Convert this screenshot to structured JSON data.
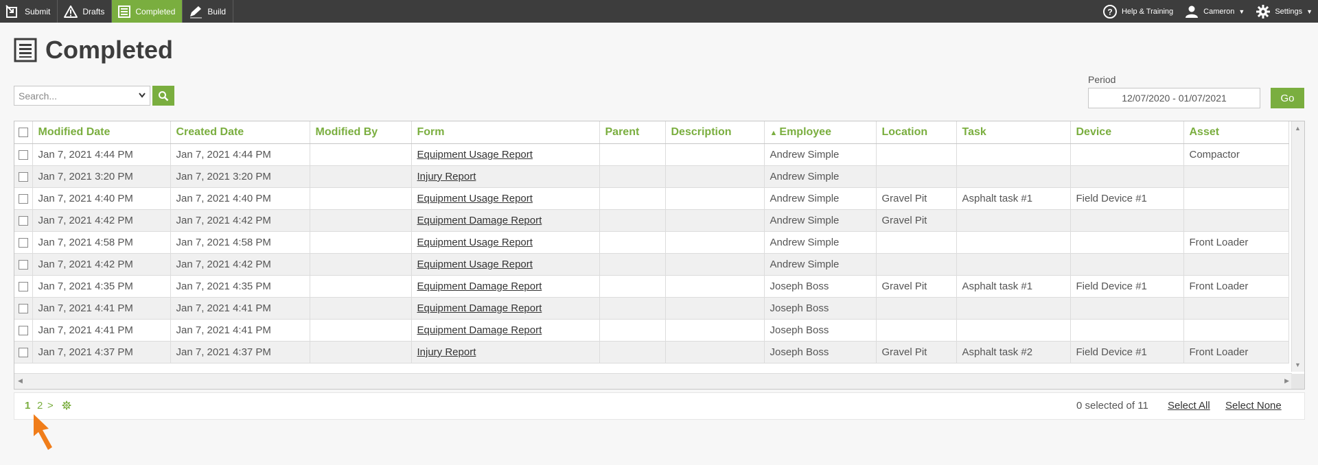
{
  "nav": {
    "items": [
      {
        "label": "Submit",
        "icon": "submit-icon",
        "active": false
      },
      {
        "label": "Drafts",
        "icon": "warning-icon",
        "active": false
      },
      {
        "label": "Completed",
        "icon": "document-icon",
        "active": true
      },
      {
        "label": "Build",
        "icon": "pencil-icon",
        "active": false
      }
    ],
    "help_label": "Help & Training",
    "user_label": "Cameron",
    "settings_label": "Settings"
  },
  "page": {
    "title": "Completed"
  },
  "search": {
    "placeholder": "Search..."
  },
  "period": {
    "label": "Period",
    "value": "12/07/2020 - 01/07/2021",
    "go_label": "Go"
  },
  "table": {
    "columns": [
      "Modified Date",
      "Created Date",
      "Modified By",
      "Form",
      "Parent",
      "Description",
      "Employee",
      "Location",
      "Task",
      "Device",
      "Asset"
    ],
    "sorted_column": "Employee",
    "rows": [
      [
        "Jan 7, 2021 4:44 PM",
        "Jan 7, 2021 4:44 PM",
        "",
        "Equipment Usage Report",
        "",
        "",
        "Andrew Simple",
        "",
        "",
        "",
        "Compactor"
      ],
      [
        "Jan 7, 2021 3:20 PM",
        "Jan 7, 2021 3:20 PM",
        "",
        "Injury Report",
        "",
        "",
        "Andrew Simple",
        "",
        "",
        "",
        ""
      ],
      [
        "Jan 7, 2021 4:40 PM",
        "Jan 7, 2021 4:40 PM",
        "",
        "Equipment Usage Report",
        "",
        "",
        "Andrew Simple",
        "Gravel Pit",
        "Asphalt task #1",
        "Field Device #1",
        ""
      ],
      [
        "Jan 7, 2021 4:42 PM",
        "Jan 7, 2021 4:42 PM",
        "",
        "Equipment Damage Report",
        "",
        "",
        "Andrew Simple",
        "Gravel Pit",
        "",
        "",
        ""
      ],
      [
        "Jan 7, 2021 4:58 PM",
        "Jan 7, 2021 4:58 PM",
        "",
        "Equipment Usage Report",
        "",
        "",
        "Andrew Simple",
        "",
        "",
        "",
        "Front Loader"
      ],
      [
        "Jan 7, 2021 4:42 PM",
        "Jan 7, 2021 4:42 PM",
        "",
        "Equipment Usage Report",
        "",
        "",
        "Andrew Simple",
        "",
        "",
        "",
        ""
      ],
      [
        "Jan 7, 2021 4:35 PM",
        "Jan 7, 2021 4:35 PM",
        "",
        "Equipment Damage Report",
        "",
        "",
        "Joseph Boss",
        "Gravel Pit",
        "Asphalt task #1",
        "Field Device #1",
        "Front Loader"
      ],
      [
        "Jan 7, 2021 4:41 PM",
        "Jan 7, 2021 4:41 PM",
        "",
        "Equipment Damage Report",
        "",
        "",
        "Joseph Boss",
        "",
        "",
        "",
        ""
      ],
      [
        "Jan 7, 2021 4:41 PM",
        "Jan 7, 2021 4:41 PM",
        "",
        "Equipment Damage Report",
        "",
        "",
        "Joseph Boss",
        "",
        "",
        "",
        ""
      ],
      [
        "Jan 7, 2021 4:37 PM",
        "Jan 7, 2021 4:37 PM",
        "",
        "Injury Report",
        "",
        "",
        "Joseph Boss",
        "Gravel Pit",
        "Asphalt task #2",
        "Field Device #1",
        "Front Loader"
      ]
    ]
  },
  "pager": {
    "current_page": "1",
    "next_page": "2",
    "next_symbol": ">",
    "selection_info": "0 selected of 11",
    "select_all": "Select All",
    "select_none": "Select None"
  },
  "colors": {
    "accent": "#7aae3f",
    "topbar": "#3d3d3d",
    "pointer_arrow": "#f07d1a"
  }
}
